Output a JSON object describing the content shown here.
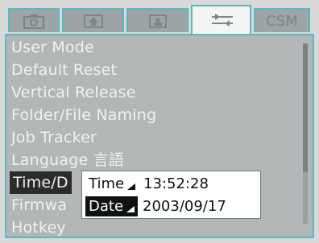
{
  "tabs": [
    {
      "name": "camera-tab",
      "icon": "camera-icon"
    },
    {
      "name": "playback-tab",
      "icon": "playback-icon"
    },
    {
      "name": "print-tab",
      "icon": "print-icon"
    },
    {
      "name": "setup-tab",
      "icon": "setup-wrench-icon",
      "active": true
    },
    {
      "name": "csm-tab",
      "label": "CSM"
    }
  ],
  "menu": {
    "items": [
      {
        "label": "User Mode"
      },
      {
        "label": "Default Reset"
      },
      {
        "label": "Vertical Release"
      },
      {
        "label": "Folder/File Naming"
      },
      {
        "label": "Job Tracker"
      },
      {
        "label": "Language 言語"
      },
      {
        "label": "Time/D",
        "selected": true
      },
      {
        "label": "Firmwa"
      },
      {
        "label": "Hotkey"
      }
    ]
  },
  "popup": {
    "time_label": "Time",
    "time_value": "13:52:28",
    "date_label": "Date",
    "date_value": "2003/09/17"
  },
  "colors": {
    "tab_border": "#5bb8bc",
    "menu_bg": "#b3b6b7",
    "selected_bg": "#2c2c2c"
  }
}
